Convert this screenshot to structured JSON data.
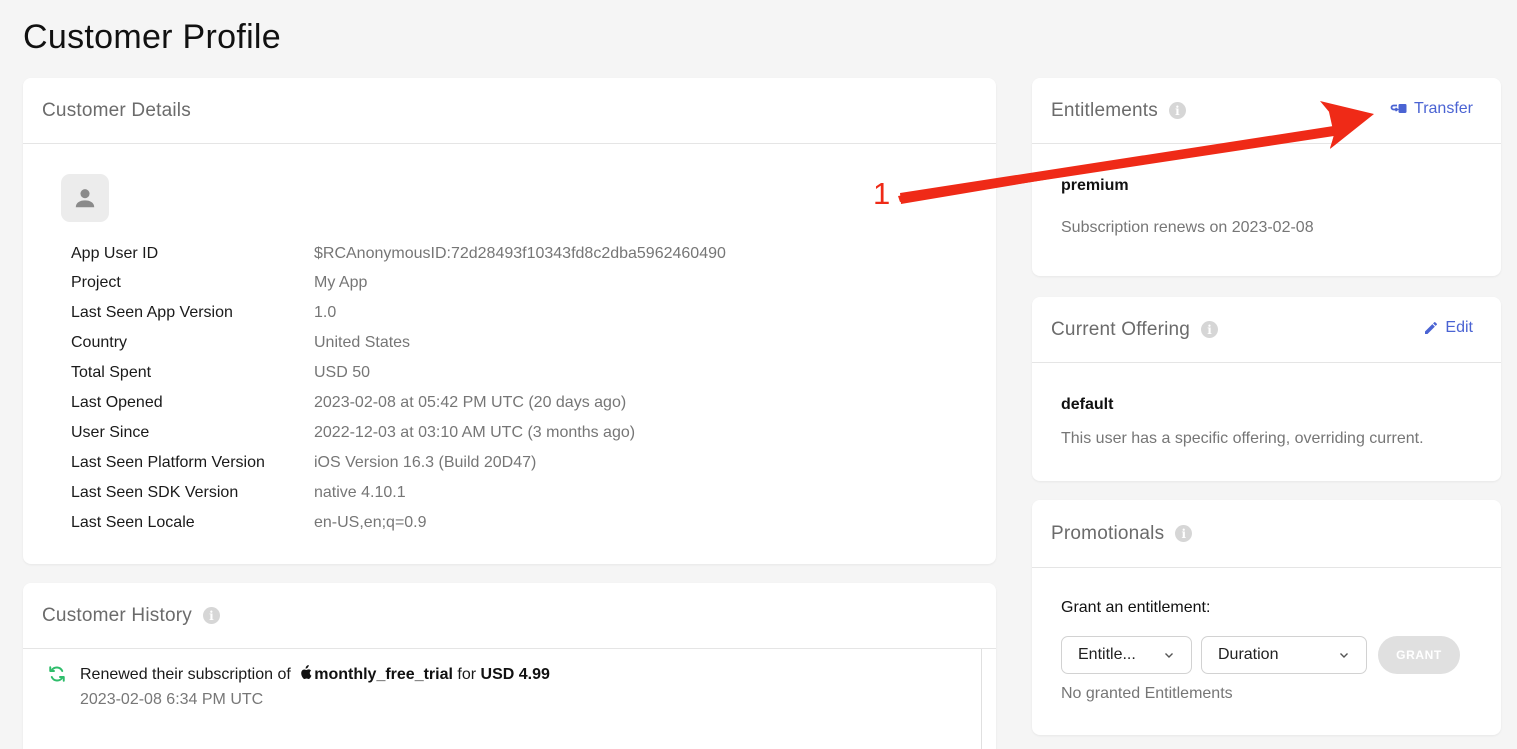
{
  "page": {
    "title": "Customer Profile"
  },
  "details": {
    "title": "Customer Details",
    "rows": [
      {
        "key": "App User ID",
        "value": "$RCAnonymousID:72d28493f10343fd8c2dba5962460490"
      },
      {
        "key": "Project",
        "value": "My App"
      },
      {
        "key": "Last Seen App Version",
        "value": "1.0"
      },
      {
        "key": "Country",
        "value": "United States"
      },
      {
        "key": "Total Spent",
        "value": "USD 50"
      },
      {
        "key": "Last Opened",
        "value": "2023-02-08 at 05:42 PM UTC (20 days ago)"
      },
      {
        "key": "User Since",
        "value": "2022-12-03 at 03:10 AM UTC (3 months ago)"
      },
      {
        "key": "Last Seen Platform Version",
        "value": "iOS Version 16.3 (Build 20D47)"
      },
      {
        "key": "Last Seen SDK Version",
        "value": "native 4.10.1"
      },
      {
        "key": "Last Seen Locale",
        "value": "en-US,en;q=0.9"
      }
    ]
  },
  "history": {
    "title": "Customer History",
    "items": [
      {
        "prefix": "Renewed their subscription of",
        "product": "monthly_free_trial",
        "middle": "for",
        "amount": "USD 4.99",
        "date": "2023-02-08 6:34 PM UTC"
      }
    ]
  },
  "entitlements": {
    "title": "Entitlements",
    "action": "Transfer",
    "name": "premium",
    "status": "Subscription renews on 2023-02-08"
  },
  "offering": {
    "title": "Current Offering",
    "action": "Edit",
    "name": "default",
    "description": "This user has a specific offering, overriding current."
  },
  "promos": {
    "title": "Promotionals",
    "grant_label": "Grant an entitlement:",
    "entitlement_select": "Entitle...",
    "duration_select": "Duration",
    "grant_button": "GRANT",
    "empty": "No granted Entitlements"
  },
  "annotation": {
    "label": "1"
  },
  "colors": {
    "accent": "#4a63d3",
    "annotation": "#ef2a17",
    "renew": "#2fbd6b"
  }
}
